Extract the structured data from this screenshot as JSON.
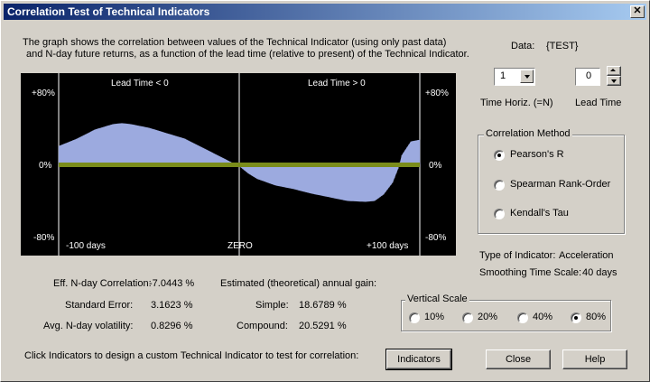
{
  "window": {
    "title": "Correlation Test of Technical Indicators",
    "close_glyph": "✕"
  },
  "description": {
    "line1": "The graph shows the correlation between values of the Technical Indicator (using only past data)",
    "line2": "and N-day future returns, as a function of the lead time (relative to present) of the Technical Indicator."
  },
  "data_source": {
    "label": "Data:",
    "value": "{TEST}"
  },
  "time_horizon": {
    "value": "1",
    "label": "Time Horiz. (=N)"
  },
  "lead_time": {
    "value": "0",
    "label": "Lead Time"
  },
  "chart_data": {
    "type": "area",
    "top_left_label": "Lead Time < 0",
    "top_right_label": "Lead Time > 0",
    "y_tick_labels": [
      "+80%",
      "0%",
      "-80%"
    ],
    "x_tick_labels": [
      "-100 days",
      "ZERO",
      "+100 days"
    ],
    "xlim": [
      -100,
      100
    ],
    "ylim": [
      -80,
      80
    ],
    "x": [
      -100,
      -90,
      -80,
      -70,
      -65,
      -60,
      -50,
      -40,
      -30,
      -20,
      -10,
      -3,
      0,
      5,
      10,
      20,
      30,
      40,
      50,
      60,
      70,
      75,
      80,
      85,
      88,
      90,
      95,
      100
    ],
    "y": [
      20,
      28,
      38,
      44,
      45,
      44,
      40,
      34,
      28,
      18,
      8,
      1,
      -2,
      -10,
      -16,
      -23,
      -27,
      -32,
      -36,
      -40,
      -41,
      -40,
      -33,
      -20,
      -5,
      10,
      25,
      27
    ],
    "colors": {
      "fill": "#8a9ad8",
      "edge": "#c8d0f0",
      "zero_line": "#7a8c1a",
      "grid": "#ffffff",
      "background": "#000000"
    }
  },
  "stats": {
    "corr_label": "Eff. N-day Correlation:",
    "corr_value": "-7.0443 %",
    "stderr_label": "Standard Error:",
    "stderr_value": "3.1623 %",
    "vol_label": "Avg. N-day volatility:",
    "vol_value": "0.8296 %",
    "gain_label": "Estimated (theoretical) annual gain:",
    "simple_label": "Simple:",
    "simple_value": "18.6789 %",
    "compound_label": "Compound:",
    "compound_value": "20.5291 %"
  },
  "correlation_method": {
    "title": "Correlation Method",
    "options": [
      {
        "label": "Pearson's R",
        "selected": true
      },
      {
        "label": "Spearman Rank-Order",
        "selected": false
      },
      {
        "label": "Kendall's Tau",
        "selected": false
      }
    ]
  },
  "indicator_info": {
    "type_label": "Type of Indicator:",
    "type_value": "Acceleration",
    "scale_label": "Smoothing Time Scale:",
    "scale_value": "40 days"
  },
  "vertical_scale": {
    "title": "Vertical Scale",
    "options": [
      {
        "label": "10%",
        "selected": false
      },
      {
        "label": "20%",
        "selected": false
      },
      {
        "label": "40%",
        "selected": false
      },
      {
        "label": "80%",
        "selected": true
      }
    ]
  },
  "footer": {
    "hint": "Click Indicators to design a custom Technical Indicator to test for correlation:",
    "indicators_button": "Indicators",
    "close_button": "Close",
    "help_button": "Help"
  }
}
